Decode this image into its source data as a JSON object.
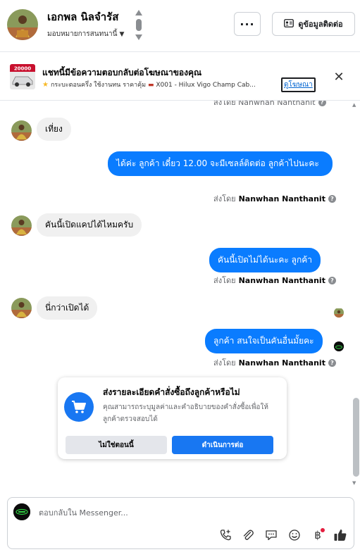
{
  "header": {
    "contact_name": "เอกพล นิลจำรัส",
    "assignee": "มอบหมายการสนทนานี้",
    "more_label": "···",
    "contact_info_label": "ดูข้อมูลติดต่อ"
  },
  "ad_banner": {
    "title": "แชทนี้มีข้อความตอบกลับต่อโฆษณาของคุณ",
    "thumb_price": "20000",
    "ad_text": "กระบะตอนครึ่ง ใช้งานทน ราคาคุ้ม",
    "ad_code": "X001 - Hilux Vigo Champ Cab...",
    "link_label": "ดูโฆษณา"
  },
  "conversation": {
    "top_sent_by": "ส่งโดย Nanwhan Nanthanit",
    "messages": [
      {
        "direction": "in",
        "text": "เที่ยง"
      },
      {
        "direction": "out",
        "text": "ได้ค่ะ ลูกค้า เดี๋ยว 12.00 จะมีเซลล์ติดต่อ ลูกค้าไปนะคะ",
        "sent_by_prefix": "ส่งโดย",
        "sent_by_name": "Nanwhan Nanthanit"
      },
      {
        "direction": "in",
        "text": "คันนี้เปิดแคปได้ไหมครับ"
      },
      {
        "direction": "out",
        "text": "คันนี้เปิดไม่ได้นะคะ ลูกค้า",
        "sent_by_prefix": "ส่งโดย",
        "sent_by_name": "Nanwhan Nanthanit"
      },
      {
        "direction": "in",
        "text": "นี่กว่าเปิดได้"
      },
      {
        "direction": "out",
        "text": "ลูกค้า สนใจเป็นคันอื่นมั้ยคะ",
        "sent_by_prefix": "ส่งโดย",
        "sent_by_name": "Nanwhan Nanthanit"
      }
    ]
  },
  "order_card": {
    "title": "ส่งรายละเอียดคำสั่งซื้อถึงลูกค้าหรือไม่",
    "description": "คุณสามารถระบุมูลค่าและคำอธิบายของคำสั่งซื้อเพื่อให้ลูกค้าตรวจสอบได้",
    "decline_label": "ไม่ใช่ตอนนี้",
    "proceed_label": "ดำเนินการต่อ"
  },
  "composer": {
    "placeholder": "ตอบกลับใน Messenger...",
    "currency_symbol": "฿"
  },
  "colors": {
    "accent": "#1877f2",
    "outgoing_bubble": "#0a7cff",
    "incoming_bubble": "#f0f0f0",
    "muted_text": "#65676b"
  },
  "icons": [
    "chevron-up-down-icon",
    "caret-down-icon",
    "more-icon",
    "contact-card-icon",
    "star-icon",
    "car-icon",
    "close-icon",
    "info-icon",
    "cart-icon",
    "add-call-icon",
    "attachment-icon",
    "saved-reply-icon",
    "emoji-icon",
    "payment-icon",
    "like-icon"
  ]
}
